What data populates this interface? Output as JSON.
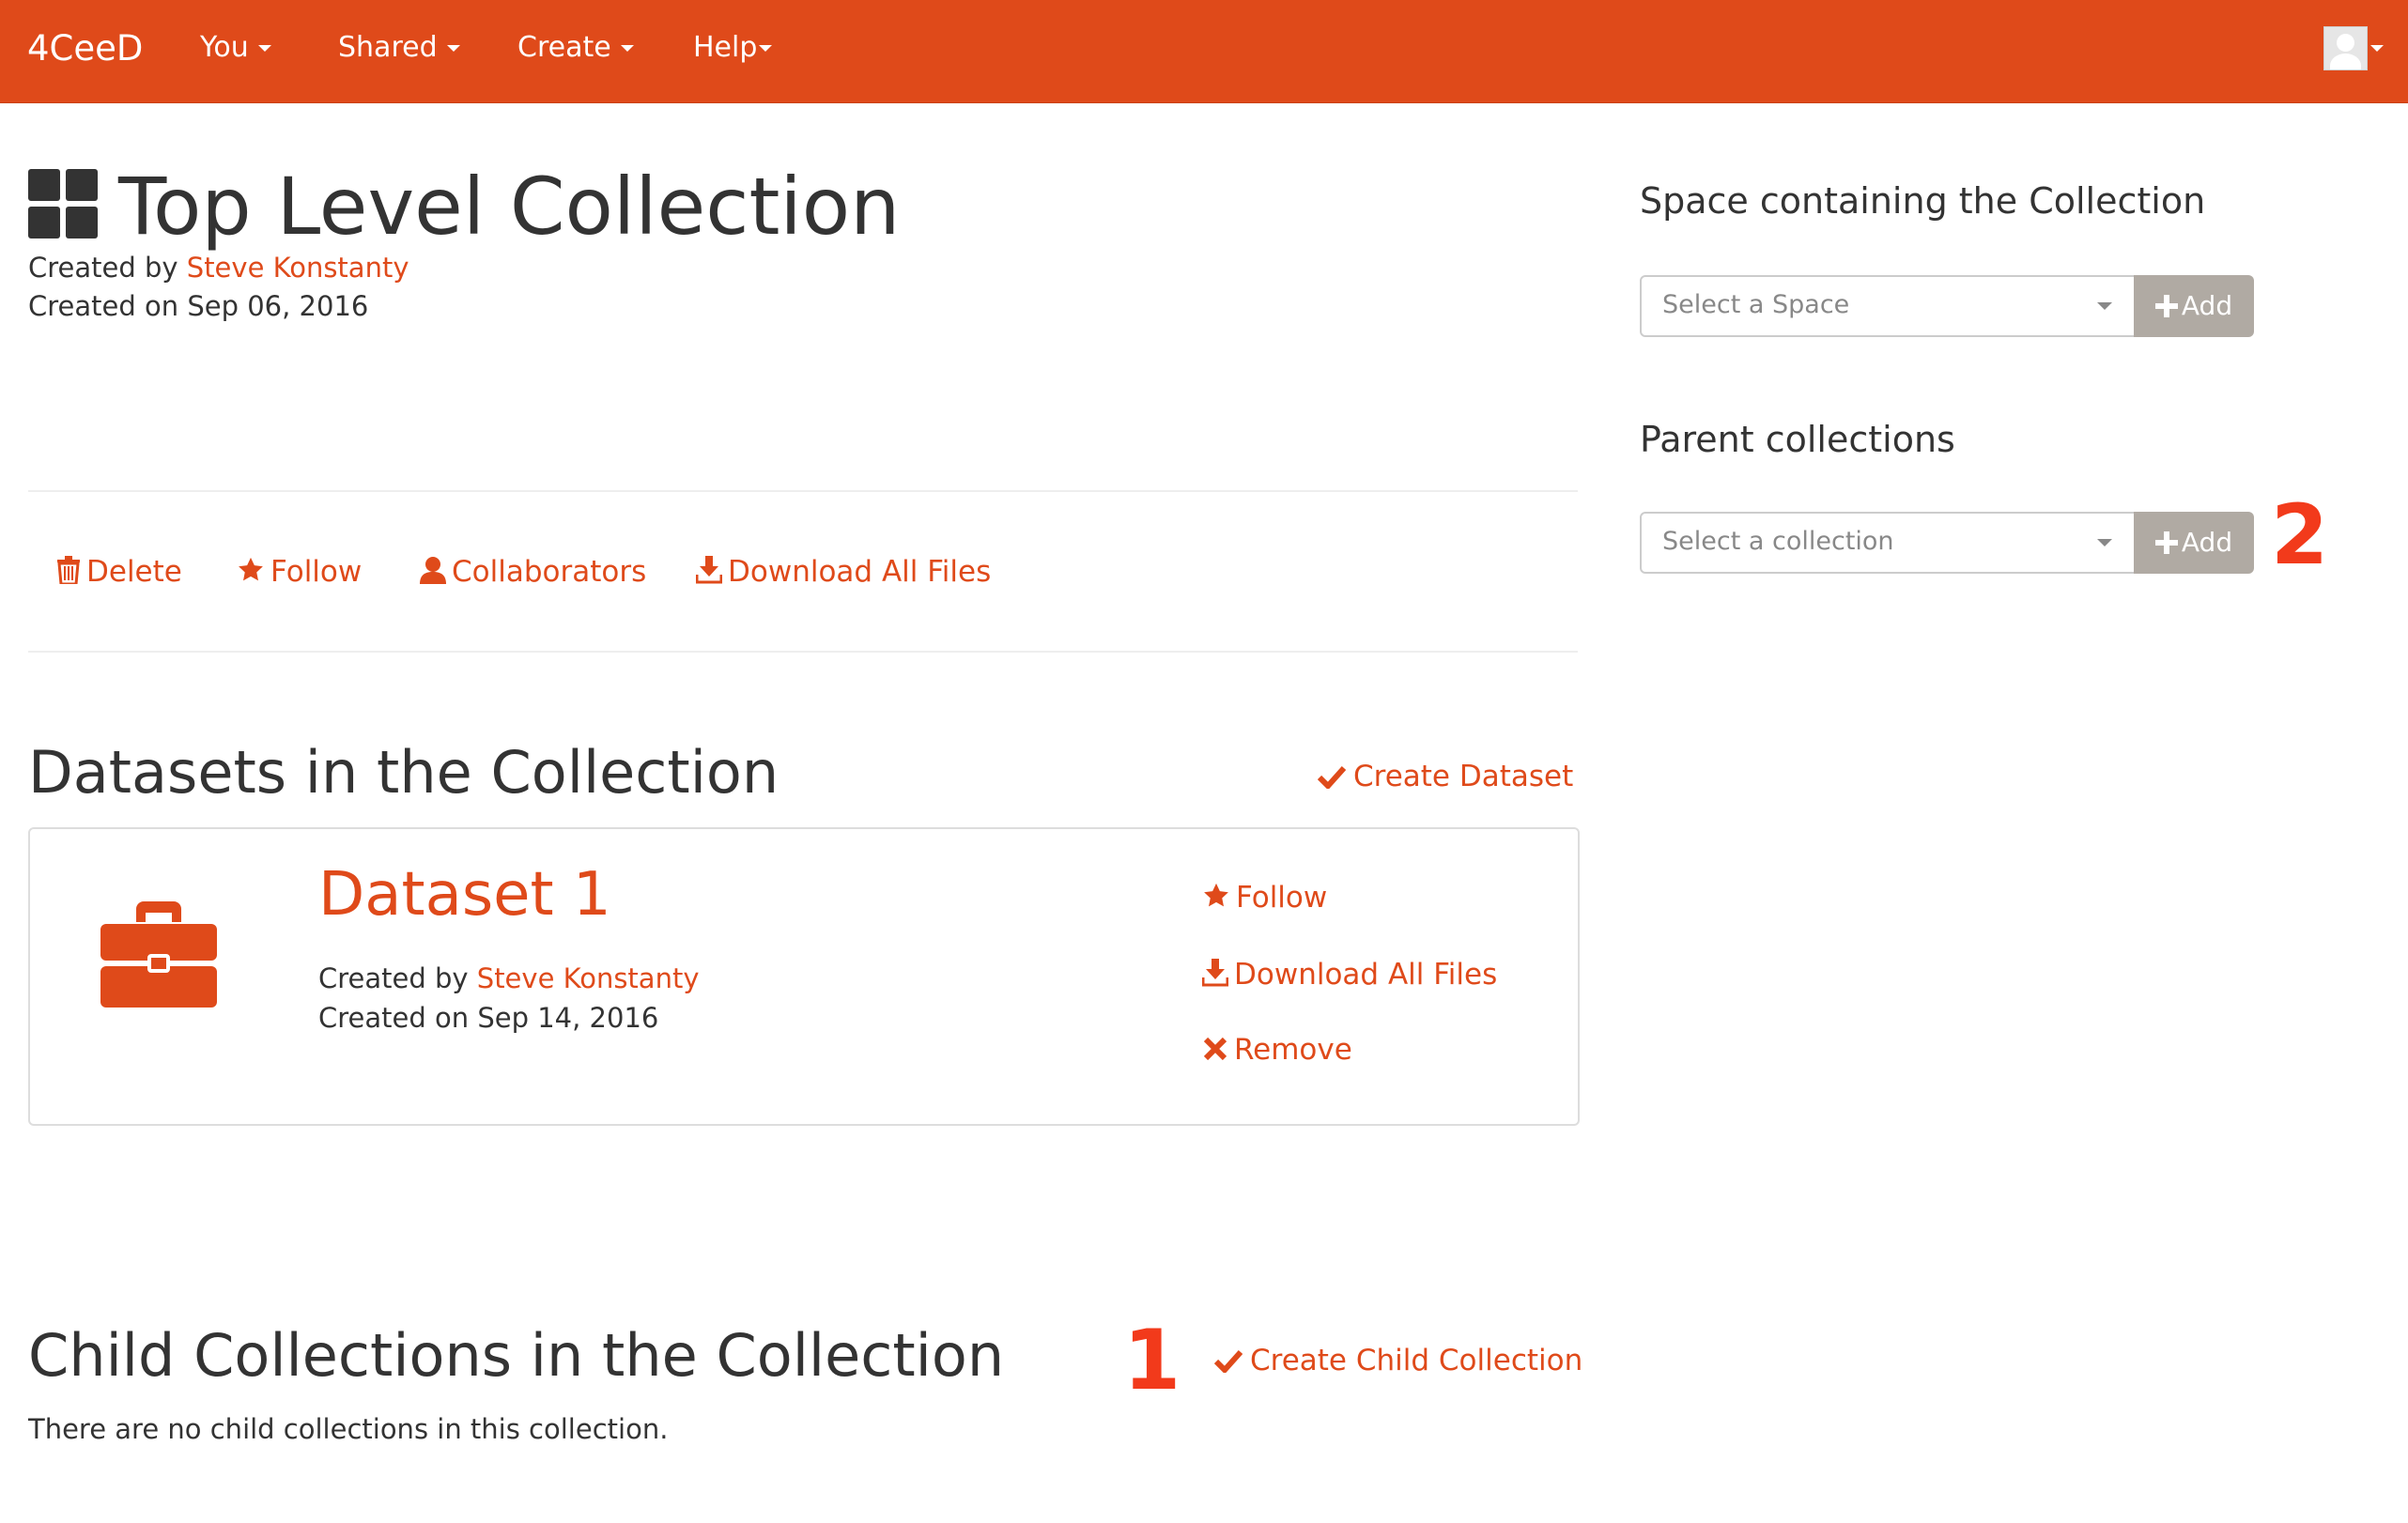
{
  "navbar": {
    "brand": "4CeeD",
    "items": [
      {
        "label": "You"
      },
      {
        "label": "Shared"
      },
      {
        "label": "Create"
      },
      {
        "label": "Help"
      }
    ]
  },
  "collection": {
    "title": "Top Level Collection",
    "created_by_prefix": "Created by ",
    "author": "Steve Konstanty",
    "created_on": "Created on Sep 06, 2016"
  },
  "actions": {
    "delete": "Delete",
    "follow": "Follow",
    "collaborators": "Collaborators",
    "download_all": "Download All Files"
  },
  "datasets_section": {
    "title": "Datasets in the Collection",
    "create_label": "Create Dataset",
    "items": [
      {
        "title": "Dataset 1",
        "created_by_prefix": "Created by ",
        "author": "Steve Konstanty",
        "created_on": "Created on Sep 14, 2016",
        "follow": "Follow",
        "download_all": "Download All Files",
        "remove": "Remove"
      }
    ]
  },
  "child_section": {
    "title": "Child Collections in the Collection",
    "create_label": "Create Child Collection",
    "empty_message": "There are no child collections in this collection."
  },
  "sidebar": {
    "space": {
      "heading": "Space containing the Collection",
      "placeholder": "Select a Space",
      "add_label": "Add"
    },
    "parent": {
      "heading": "Parent collections",
      "placeholder": "Select a collection",
      "add_label": "Add"
    }
  },
  "annotations": {
    "one": "1",
    "two": "2"
  },
  "colors": {
    "brand": "#df4a1a",
    "annotation": "#f23a1b",
    "add_button": "#b0aaa3"
  }
}
